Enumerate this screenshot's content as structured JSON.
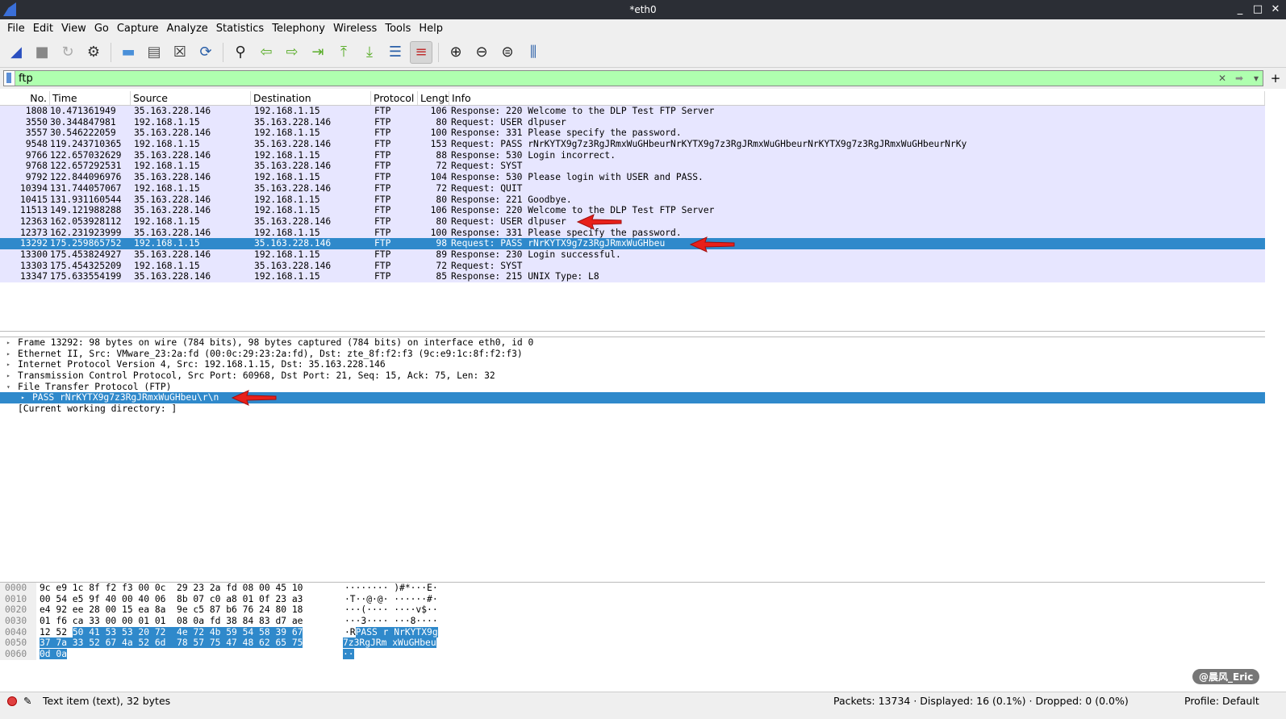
{
  "window": {
    "title": "*eth0",
    "minimize": "_",
    "maximize": "□",
    "close": "✕"
  },
  "menu": [
    "File",
    "Edit",
    "View",
    "Go",
    "Capture",
    "Analyze",
    "Statistics",
    "Telephony",
    "Wireless",
    "Tools",
    "Help"
  ],
  "toolbar": [
    {
      "name": "start-capture-icon",
      "glyph": "◢",
      "color": "#2a4fc0"
    },
    {
      "name": "stop-capture-icon",
      "glyph": "■",
      "color": "#888"
    },
    {
      "name": "restart-capture-icon",
      "glyph": "↻",
      "color": "#aaa"
    },
    {
      "name": "capture-options-icon",
      "glyph": "⚙",
      "color": "#333"
    },
    {
      "sep": true
    },
    {
      "name": "open-file-icon",
      "glyph": "▬",
      "color": "#4a90d9"
    },
    {
      "name": "save-file-icon",
      "glyph": "▤",
      "color": "#555"
    },
    {
      "name": "close-file-icon",
      "glyph": "☒",
      "color": "#333"
    },
    {
      "name": "reload-file-icon",
      "glyph": "⟳",
      "color": "#2a5fa8"
    },
    {
      "sep": true
    },
    {
      "name": "find-packet-icon",
      "glyph": "⚲",
      "color": "#222"
    },
    {
      "name": "go-back-icon",
      "glyph": "⇦",
      "color": "#5aad2a"
    },
    {
      "name": "go-forward-icon",
      "glyph": "⇨",
      "color": "#5aad2a"
    },
    {
      "name": "go-to-packet-icon",
      "glyph": "⇥",
      "color": "#5aad2a"
    },
    {
      "name": "first-packet-icon",
      "glyph": "⤒",
      "color": "#5aad2a"
    },
    {
      "name": "last-packet-icon",
      "glyph": "⤓",
      "color": "#5aad2a"
    },
    {
      "name": "autoscroll-icon",
      "glyph": "☰",
      "color": "#2a5fa8"
    },
    {
      "name": "colorize-icon",
      "glyph": "≡",
      "color": "#c03030",
      "active": true
    },
    {
      "sep": true
    },
    {
      "name": "zoom-in-icon",
      "glyph": "⊕",
      "color": "#222"
    },
    {
      "name": "zoom-out-icon",
      "glyph": "⊖",
      "color": "#222"
    },
    {
      "name": "zoom-reset-icon",
      "glyph": "⊜",
      "color": "#222"
    },
    {
      "name": "resize-columns-icon",
      "glyph": "⫼",
      "color": "#2a5fa8"
    }
  ],
  "filter": {
    "value": "ftp",
    "clear": "✕",
    "apply": "➡",
    "dropdown": "▾",
    "add": "+"
  },
  "columns": [
    "No.",
    "Time",
    "Source",
    "Destination",
    "Protocol",
    "Length",
    "Info"
  ],
  "packets": [
    [
      "1808",
      "10.471361949",
      "35.163.228.146",
      "192.168.1.15",
      "FTP",
      "106",
      "Response: 220 Welcome to the DLP Test FTP Server"
    ],
    [
      "3550",
      "30.344847981",
      "192.168.1.15",
      "35.163.228.146",
      "FTP",
      "80",
      "Request: USER dlpuser"
    ],
    [
      "3557",
      "30.546222059",
      "35.163.228.146",
      "192.168.1.15",
      "FTP",
      "100",
      "Response: 331 Please specify the password."
    ],
    [
      "9548",
      "119.243710365",
      "192.168.1.15",
      "35.163.228.146",
      "FTP",
      "153",
      "Request: PASS rNrKYTX9g7z3RgJRmxWuGHbeurNrKYTX9g7z3RgJRmxWuGHbeurNrKYTX9g7z3RgJRmxWuGHbeurNrKy"
    ],
    [
      "9766",
      "122.657032629",
      "35.163.228.146",
      "192.168.1.15",
      "FTP",
      "88",
      "Response: 530 Login incorrect."
    ],
    [
      "9768",
      "122.657292531",
      "192.168.1.15",
      "35.163.228.146",
      "FTP",
      "72",
      "Request: SYST"
    ],
    [
      "9792",
      "122.844096976",
      "35.163.228.146",
      "192.168.1.15",
      "FTP",
      "104",
      "Response: 530 Please login with USER and PASS."
    ],
    [
      "10394",
      "131.744057067",
      "192.168.1.15",
      "35.163.228.146",
      "FTP",
      "72",
      "Request: QUIT"
    ],
    [
      "10415",
      "131.931160544",
      "35.163.228.146",
      "192.168.1.15",
      "FTP",
      "80",
      "Response: 221 Goodbye."
    ],
    [
      "11513",
      "149.121988288",
      "35.163.228.146",
      "192.168.1.15",
      "FTP",
      "106",
      "Response: 220 Welcome to the DLP Test FTP Server"
    ],
    [
      "12363",
      "162.053928112",
      "192.168.1.15",
      "35.163.228.146",
      "FTP",
      "80",
      "Request: USER dlpuser"
    ],
    [
      "12373",
      "162.231923999",
      "35.163.228.146",
      "192.168.1.15",
      "FTP",
      "100",
      "Response: 331 Please specify the password."
    ],
    [
      "13292",
      "175.259865752",
      "192.168.1.15",
      "35.163.228.146",
      "FTP",
      "98",
      "Request: PASS rNrKYTX9g7z3RgJRmxWuGHbeu"
    ],
    [
      "13300",
      "175.453824927",
      "35.163.228.146",
      "192.168.1.15",
      "FTP",
      "89",
      "Response: 230 Login successful."
    ],
    [
      "13303",
      "175.454325209",
      "192.168.1.15",
      "35.163.228.146",
      "FTP",
      "72",
      "Request: SYST"
    ],
    [
      "13347",
      "175.633554199",
      "35.163.228.146",
      "192.168.1.15",
      "FTP",
      "85",
      "Response: 215 UNIX Type: L8"
    ]
  ],
  "selected_packet": "13292",
  "details": [
    {
      "text": "Frame 13292: 98 bytes on wire (784 bits), 98 bytes captured (784 bits) on interface eth0, id 0",
      "tri": "▸",
      "indent": 0
    },
    {
      "text": "Ethernet II, Src: VMware_23:2a:fd (00:0c:29:23:2a:fd), Dst: zte_8f:f2:f3 (9c:e9:1c:8f:f2:f3)",
      "tri": "▸",
      "indent": 0
    },
    {
      "text": "Internet Protocol Version 4, Src: 192.168.1.15, Dst: 35.163.228.146",
      "tri": "▸",
      "indent": 0
    },
    {
      "text": "Transmission Control Protocol, Src Port: 60968, Dst Port: 21, Seq: 15, Ack: 75, Len: 32",
      "tri": "▸",
      "indent": 0
    },
    {
      "text": "File Transfer Protocol (FTP)",
      "tri": "▾",
      "indent": 0
    },
    {
      "text": "PASS rNrKYTX9g7z3RgJRmxWuGHbeu\\r\\n",
      "tri": "▸",
      "indent": 1,
      "selected": true
    },
    {
      "text": "[Current working directory: ]",
      "tri": "",
      "indent": 0
    }
  ],
  "bytes": [
    {
      "off": "0000",
      "hex": [
        "9c e9 1c 8f f2 f3 00 0c  29 23 2a fd 08 00 45 10",
        ""
      ],
      "asc": [
        "········ )#*···E·",
        ""
      ]
    },
    {
      "off": "0010",
      "hex": [
        "00 54 e5 9f 40 00 40 06  8b 07 c0 a8 01 0f 23 a3",
        ""
      ],
      "asc": [
        "·T··@·@· ······#·",
        ""
      ]
    },
    {
      "off": "0020",
      "hex": [
        "e4 92 ee 28 00 15 ea 8a  9e c5 87 b6 76 24 80 18",
        ""
      ],
      "asc": [
        "···(···· ····v$··",
        ""
      ]
    },
    {
      "off": "0030",
      "hex": [
        "01 f6 ca 33 00 00 01 01  08 0a fd 38 84 83 d7 ae",
        ""
      ],
      "asc": [
        "···3···· ···8····",
        ""
      ]
    },
    {
      "off": "0040",
      "hex": [
        "12 52 ",
        "50 41 53 53 20 72  4e 72 4b 59 54 58 39 67"
      ],
      "asc": [
        "·R",
        "PASS r NrKYTX9g"
      ]
    },
    {
      "off": "0050",
      "hex": [
        "",
        "37 7a 33 52 67 4a 52 6d  78 57 75 47 48 62 65 75"
      ],
      "asc": [
        "",
        "7z3RgJRm xWuGHbeu"
      ]
    },
    {
      "off": "0060",
      "hex": [
        "",
        "0d 0a"
      ],
      "asc": [
        "",
        "··"
      ]
    }
  ],
  "status": {
    "item": "Text item (text), 32 bytes",
    "packets": "Packets: 13734 · Displayed: 16 (0.1%) · Dropped: 0 (0.0%)",
    "profile": "Profile: Default"
  },
  "watermark": "@晨风_Eric",
  "colors": {
    "selection": "#2f89cb",
    "row_bg": "#e7e6ff",
    "filter_valid": "#afffaf",
    "arrow": "#e8201a"
  }
}
